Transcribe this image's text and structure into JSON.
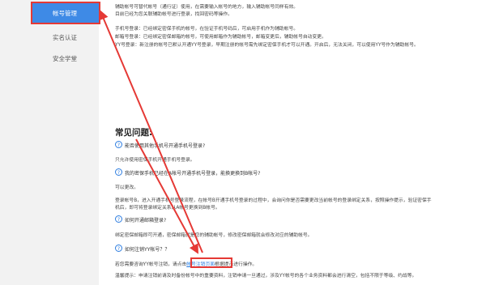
{
  "sidebar": {
    "items": [
      {
        "label": "帐号管理"
      },
      {
        "label": "实名认证"
      },
      {
        "label": "安全学堂"
      }
    ]
  },
  "intro": {
    "lines": [
      "辅助帐号可替代帐号（通行证）使用，在需要输入帐号的地方，输入辅助帐号同样有效。",
      "目前已经为您关联辅助帐号进行登录，找回密码等操作。",
      "手机号登录：已经绑定密保手机的帐号，在验证手机号码后，可启用手机作为辅助帐号。",
      "邮箱号登录：已经绑定密保邮箱的帐号，可使用邮箱作为辅助帐号，邮箱变更后，辅助帐号自动变更。",
      "YY号登录：新注册的帐号已默认开通YY号登录，早期注册的帐号需先绑定密保手机才可以开通。开启后，无法关闭，可以使用YY号作为辅助帐号。"
    ]
  },
  "faq": {
    "title": "常见问题:",
    "items": [
      {
        "question": "能否使用其他手机号开通手机号登录?",
        "answer": "只允许使用密保手机开通手机号登录。"
      },
      {
        "question": "我的密保手机已经在A帐号开通手机号登录，能换更换到B帐号?",
        "answer": "可以更改。"
      },
      {
        "question": "如何开通邮箱登录?",
        "answer": "绑定密保邮箱即可开通，密保邮箱就是您的辅助帐号，修改密保邮箱就会修改对应的辅助帐号。"
      },
      {
        "question": "如何注销YY帐号？？",
        "answer": ""
      }
    ],
    "change_para_1": "登录帐号B，进入开通手机号登录流程，在帐号B开通手机号登录的过程中，会询问你是否需要更改当前帐号的登录绑定关系，按照操作提示，验证密保手",
    "change_para_2": "机后，即可将登录绑定关系从A帐号更换到B帐号。",
    "cancel_prefix": "若您需要咨询YY帐号注销，请点击",
    "cancel_link": "帐号注销页面",
    "cancel_suffix": "根据提示进行操作。",
    "warm_tip": "温馨提示：申请注销前请及时备份帐号中的重要资料，注销申请一旦通过，涉及YY帐号的各个业务资料都会进行清空，包括不限于等级、约战等。"
  }
}
